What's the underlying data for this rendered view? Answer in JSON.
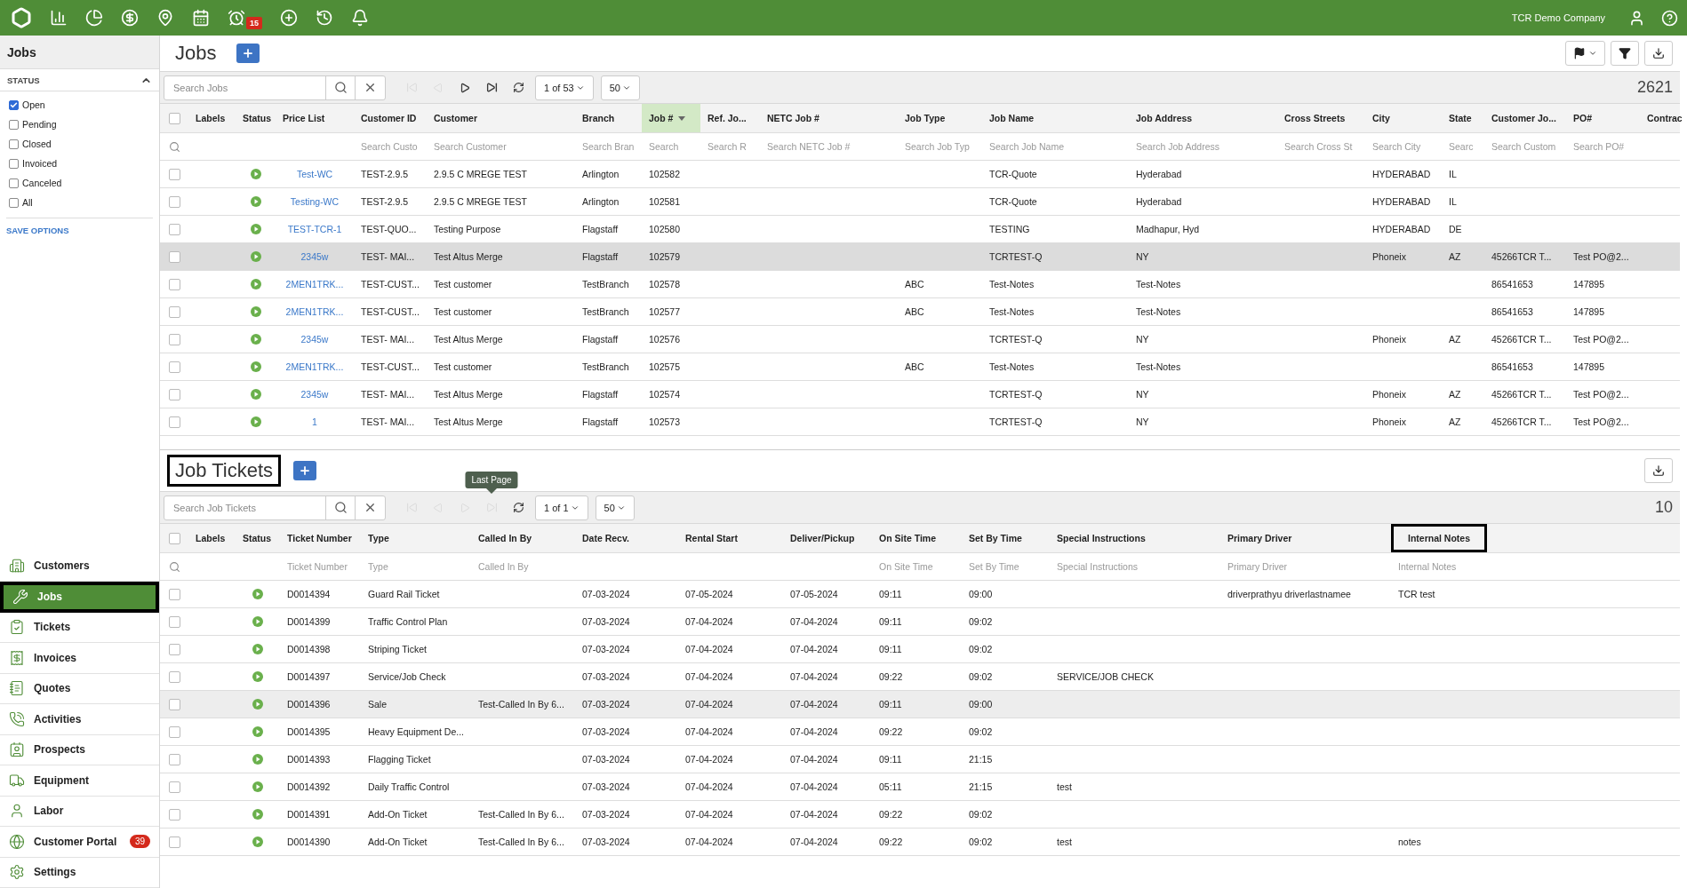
{
  "top_bar": {
    "alarm_badge": "15",
    "company": "TCR Demo Company"
  },
  "sidebar": {
    "title": "Jobs",
    "filter": {
      "heading": "STATUS",
      "expanded": true,
      "save": "SAVE OPTIONS",
      "options": [
        {
          "label": "Open",
          "checked": true
        },
        {
          "label": "Pending",
          "checked": false
        },
        {
          "label": "Closed",
          "checked": false
        },
        {
          "label": "Invoiced",
          "checked": false
        },
        {
          "label": "Canceled",
          "checked": false
        },
        {
          "label": "All",
          "checked": false
        }
      ]
    },
    "nav": [
      {
        "label": "Customers",
        "selected": false,
        "outlined": false
      },
      {
        "label": "Jobs",
        "selected": true,
        "outlined": true
      },
      {
        "label": "Tickets",
        "selected": false,
        "outlined": false
      },
      {
        "label": "Invoices",
        "selected": false,
        "outlined": false
      },
      {
        "label": "Quotes",
        "selected": false,
        "outlined": false
      },
      {
        "label": "Activities",
        "selected": false,
        "outlined": false
      },
      {
        "label": "Prospects",
        "selected": false,
        "outlined": false
      },
      {
        "label": "Equipment",
        "selected": false,
        "outlined": false
      },
      {
        "label": "Labor",
        "selected": false,
        "outlined": false
      },
      {
        "label": "Customer Portal",
        "selected": false,
        "outlined": false,
        "badge": "39"
      },
      {
        "label": "Settings",
        "selected": false,
        "outlined": false
      }
    ]
  },
  "jobs": {
    "title": "Jobs",
    "outlined": false,
    "toolbar": {
      "search_placeholder": "Search Jobs",
      "page": "1 of 53",
      "page_size": "50",
      "count": "2621",
      "pager": [
        {
          "kind": "first",
          "disabled": true
        },
        {
          "kind": "prev",
          "disabled": true
        },
        {
          "kind": "next",
          "disabled": false
        },
        {
          "kind": "last",
          "disabled": false
        }
      ]
    },
    "select_all_checked": false,
    "columns": [
      {
        "label": "Labels",
        "kind": "labels",
        "sorted": false
      },
      {
        "label": "Status",
        "kind": "status",
        "sorted": false
      },
      {
        "label": "Price List",
        "kind": "link",
        "sorted": false
      },
      {
        "label": "Customer ID",
        "kind": "text",
        "sorted": false,
        "placeholder": "Search Custo"
      },
      {
        "label": "Customer",
        "kind": "text",
        "sorted": false,
        "placeholder": "Search Customer"
      },
      {
        "label": "Branch",
        "kind": "text",
        "sorted": false,
        "placeholder": "Search Bran"
      },
      {
        "label": "Job #",
        "kind": "text",
        "sorted": true,
        "placeholder": "Search"
      },
      {
        "label": "Ref. Jo...",
        "kind": "text",
        "sorted": false,
        "placeholder": "Search R"
      },
      {
        "label": "NETC Job #",
        "kind": "text",
        "sorted": false,
        "placeholder": "Search NETC Job #"
      },
      {
        "label": "Job Type",
        "kind": "text",
        "sorted": false,
        "placeholder": "Search Job Typ"
      },
      {
        "label": "Job Name",
        "kind": "text",
        "sorted": false,
        "placeholder": "Search Job Name"
      },
      {
        "label": "Job Address",
        "kind": "text",
        "sorted": false,
        "placeholder": "Search Job Address"
      },
      {
        "label": "Cross Streets",
        "kind": "text",
        "sorted": false,
        "placeholder": "Search Cross St"
      },
      {
        "label": "City",
        "kind": "text",
        "sorted": false,
        "placeholder": "Search City"
      },
      {
        "label": "State",
        "kind": "text",
        "sorted": false,
        "placeholder": "Searc"
      },
      {
        "label": "Customer Jo...",
        "kind": "text",
        "sorted": false,
        "placeholder": "Search Custom"
      },
      {
        "label": "PO#",
        "kind": "text",
        "sorted": false,
        "placeholder": "Search PO#"
      },
      {
        "label": "Contrac",
        "kind": "text",
        "sorted": false
      }
    ],
    "rows": [
      {
        "selected": false,
        "checked": false,
        "cells": [
          null,
          null,
          "Test-WC",
          "TEST-2.9.5",
          "2.9.5 C MREGE TEST",
          "Arlington",
          "102582",
          null,
          null,
          null,
          "TCR-Quote",
          "Hyderabad",
          null,
          "HYDERABAD",
          "IL",
          null,
          null,
          null
        ]
      },
      {
        "selected": false,
        "checked": false,
        "cells": [
          null,
          null,
          "Testing-WC",
          "TEST-2.9.5",
          "2.9.5 C MREGE TEST",
          "Arlington",
          "102581",
          null,
          null,
          null,
          "TCR-Quote",
          "Hyderabad",
          null,
          "HYDERABAD",
          "IL",
          null,
          null,
          null
        ]
      },
      {
        "selected": false,
        "checked": false,
        "cells": [
          null,
          null,
          "TEST-TCR-1",
          "TEST-QUO...",
          "Testing Purpose",
          "Flagstaff",
          "102580",
          null,
          null,
          null,
          "TESTING",
          "Madhapur, Hyd",
          null,
          "HYDERABAD",
          "DE",
          null,
          null,
          null
        ]
      },
      {
        "selected": true,
        "checked": false,
        "cells": [
          null,
          null,
          "2345w",
          "TEST- MAI...",
          "Test Altus Merge",
          "Flagstaff",
          "102579",
          null,
          null,
          null,
          "TCRTEST-Q",
          "NY",
          null,
          "Phoneix",
          "AZ",
          "45266TCR T...",
          "Test PO@2...",
          null
        ]
      },
      {
        "selected": false,
        "checked": false,
        "cells": [
          null,
          null,
          "2MEN1TRK...",
          "TEST-CUST...",
          "Test customer",
          "TestBranch",
          "102578",
          null,
          null,
          "ABC",
          "Test-Notes",
          "Test-Notes",
          null,
          null,
          null,
          "86541653",
          "147895",
          null
        ]
      },
      {
        "selected": false,
        "checked": false,
        "cells": [
          null,
          null,
          "2MEN1TRK...",
          "TEST-CUST...",
          "Test customer",
          "TestBranch",
          "102577",
          null,
          null,
          "ABC",
          "Test-Notes",
          "Test-Notes",
          null,
          null,
          null,
          "86541653",
          "147895",
          null
        ]
      },
      {
        "selected": false,
        "checked": false,
        "cells": [
          null,
          null,
          "2345w",
          "TEST- MAI...",
          "Test Altus Merge",
          "Flagstaff",
          "102576",
          null,
          null,
          null,
          "TCRTEST-Q",
          "NY",
          null,
          "Phoneix",
          "AZ",
          "45266TCR T...",
          "Test PO@2...",
          null
        ]
      },
      {
        "selected": false,
        "checked": false,
        "cells": [
          null,
          null,
          "2MEN1TRK...",
          "TEST-CUST...",
          "Test customer",
          "TestBranch",
          "102575",
          null,
          null,
          "ABC",
          "Test-Notes",
          "Test-Notes",
          null,
          null,
          null,
          "86541653",
          "147895",
          null
        ]
      },
      {
        "selected": false,
        "checked": false,
        "cells": [
          null,
          null,
          "2345w",
          "TEST- MAI...",
          "Test Altus Merge",
          "Flagstaff",
          "102574",
          null,
          null,
          null,
          "TCRTEST-Q",
          "NY",
          null,
          "Phoneix",
          "AZ",
          "45266TCR T...",
          "Test PO@2...",
          null
        ]
      },
      {
        "selected": false,
        "checked": false,
        "cells": [
          null,
          null,
          "1",
          "TEST- MAI...",
          "Test Altus Merge",
          "Flagstaff",
          "102573",
          null,
          null,
          null,
          "TCRTEST-Q",
          "NY",
          null,
          "Phoneix",
          "AZ",
          "45266TCR T...",
          "Test PO@2...",
          null
        ]
      }
    ]
  },
  "tickets": {
    "title": "Job Tickets",
    "outlined": true,
    "toolbar": {
      "search_placeholder": "Search Job Tickets",
      "page": "1 of 1",
      "page_size": "50",
      "count": "10",
      "pager": [
        {
          "kind": "first",
          "disabled": true
        },
        {
          "kind": "prev",
          "disabled": true
        },
        {
          "kind": "next",
          "disabled": true
        },
        {
          "kind": "last",
          "disabled": true,
          "tooltip": "Last Page"
        }
      ]
    },
    "select_all_checked": false,
    "columns": [
      {
        "label": "Labels",
        "kind": "labels",
        "outlined": false
      },
      {
        "label": "Status",
        "kind": "status",
        "outlined": false
      },
      {
        "label": "Ticket Number",
        "kind": "text",
        "outlined": false,
        "placeholder": "Ticket Number"
      },
      {
        "label": "Type",
        "kind": "text",
        "outlined": false,
        "placeholder": "Type"
      },
      {
        "label": "Called In By",
        "kind": "text",
        "outlined": false,
        "placeholder": "Called In By"
      },
      {
        "label": "Date Recv.",
        "kind": "text",
        "outlined": false
      },
      {
        "label": "Rental Start",
        "kind": "text",
        "outlined": false
      },
      {
        "label": "Deliver/Pickup",
        "kind": "text",
        "outlined": false
      },
      {
        "label": "On Site Time",
        "kind": "text",
        "outlined": false,
        "placeholder": "On Site Time"
      },
      {
        "label": "Set By Time",
        "kind": "text",
        "outlined": false,
        "placeholder": "Set By Time"
      },
      {
        "label": "Special Instructions",
        "kind": "text",
        "outlined": false,
        "placeholder": "Special Instructions"
      },
      {
        "label": "Primary Driver",
        "kind": "text",
        "outlined": false,
        "placeholder": "Primary Driver"
      },
      {
        "label": "Internal Notes",
        "kind": "text",
        "outlined": true,
        "placeholder": "Internal Notes"
      }
    ],
    "rows": [
      {
        "selected": false,
        "checked": false,
        "cells": [
          null,
          null,
          "D0014394",
          "Guard Rail Ticket",
          null,
          "07-03-2024",
          "07-05-2024",
          "07-05-2024",
          "09:11",
          "09:00",
          null,
          "driverprathyu driverlastnamee",
          "TCR test"
        ]
      },
      {
        "selected": false,
        "checked": false,
        "cells": [
          null,
          null,
          "D0014399",
          "Traffic Control Plan",
          null,
          "07-03-2024",
          "07-04-2024",
          "07-04-2024",
          "09:11",
          "09:02",
          null,
          null,
          null
        ]
      },
      {
        "selected": false,
        "checked": false,
        "cells": [
          null,
          null,
          "D0014398",
          "Striping Ticket",
          null,
          "07-03-2024",
          "07-04-2024",
          "07-04-2024",
          "09:11",
          "09:02",
          null,
          null,
          null
        ]
      },
      {
        "selected": false,
        "checked": false,
        "cells": [
          null,
          null,
          "D0014397",
          "Service/Job Check",
          null,
          "07-03-2024",
          "07-04-2024",
          "07-04-2024",
          "09:22",
          "09:02",
          "SERVICE/JOB CHECK",
          null,
          null
        ]
      },
      {
        "selected": true,
        "checked": false,
        "cells": [
          null,
          null,
          "D0014396",
          "Sale",
          "Test-Called In By 6...",
          "07-03-2024",
          "07-04-2024",
          "07-04-2024",
          "09:11",
          "09:00",
          null,
          null,
          null
        ]
      },
      {
        "selected": false,
        "checked": false,
        "cells": [
          null,
          null,
          "D0014395",
          "Heavy Equipment De...",
          null,
          "07-03-2024",
          "07-04-2024",
          "07-04-2024",
          "09:22",
          "09:02",
          null,
          null,
          null
        ]
      },
      {
        "selected": false,
        "checked": false,
        "cells": [
          null,
          null,
          "D0014393",
          "Flagging Ticket",
          null,
          "07-03-2024",
          "07-04-2024",
          "07-04-2024",
          "09:11",
          "21:15",
          null,
          null,
          null
        ]
      },
      {
        "selected": false,
        "checked": false,
        "cells": [
          null,
          null,
          "D0014392",
          "Daily Traffic Control",
          null,
          "07-03-2024",
          "07-04-2024",
          "07-04-2024",
          "05:11",
          "21:15",
          "test",
          null,
          null
        ]
      },
      {
        "selected": false,
        "checked": false,
        "cells": [
          null,
          null,
          "D0014391",
          "Add-On Ticket",
          "Test-Called In By 6...",
          "07-03-2024",
          "07-04-2024",
          "07-04-2024",
          "09:22",
          "09:02",
          null,
          null,
          null
        ]
      },
      {
        "selected": false,
        "checked": false,
        "cells": [
          null,
          null,
          "D0014390",
          "Add-On Ticket",
          "Test-Called In By 6...",
          "07-03-2024",
          "07-04-2024",
          "07-04-2024",
          "09:22",
          "09:02",
          "test",
          null,
          "notes"
        ]
      }
    ]
  }
}
